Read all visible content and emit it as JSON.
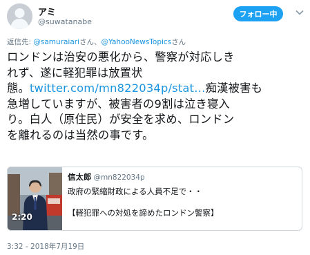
{
  "user": {
    "display_name": "アミ",
    "handle": "@suwatanabe",
    "avatar_icon": "default-profile-icon"
  },
  "header": {
    "follow_label": "フォロー中",
    "more_icon": "chevron-down-icon"
  },
  "reply": {
    "prefix": "返信先: ",
    "user1": "@samuraiari",
    "sep1": "さん、",
    "user2": "@YahooNewsTopics",
    "sep2": "さん"
  },
  "tweet": {
    "line1": "ロンドンは治安の悪化から、警察が対応しき",
    "line2": "れず、遂に軽犯罪は放置状",
    "line3_pre": "態。",
    "line3_link": "twitter.com/mn822034p/stat…",
    "line3_post": "痴漢被害も",
    "line4": "急増していますが、被害者の9割は泣き寝入",
    "line5": "り。白人（原住民）が安全を求め、ロンドン",
    "line6": "を離れるのは当然の事です。"
  },
  "card": {
    "author": "信太郎",
    "handle": "@mn822034p",
    "line1": "政府の緊縮財政による人員不足で・・",
    "line2": "【軽犯罪への対処を諦めたロンドン警察】",
    "duration": "2:20"
  },
  "timestamp": "3:32 - 2018年7月19日",
  "colors": {
    "accent": "#1da1f2",
    "link": "#1b95e0",
    "muted": "#657786"
  }
}
